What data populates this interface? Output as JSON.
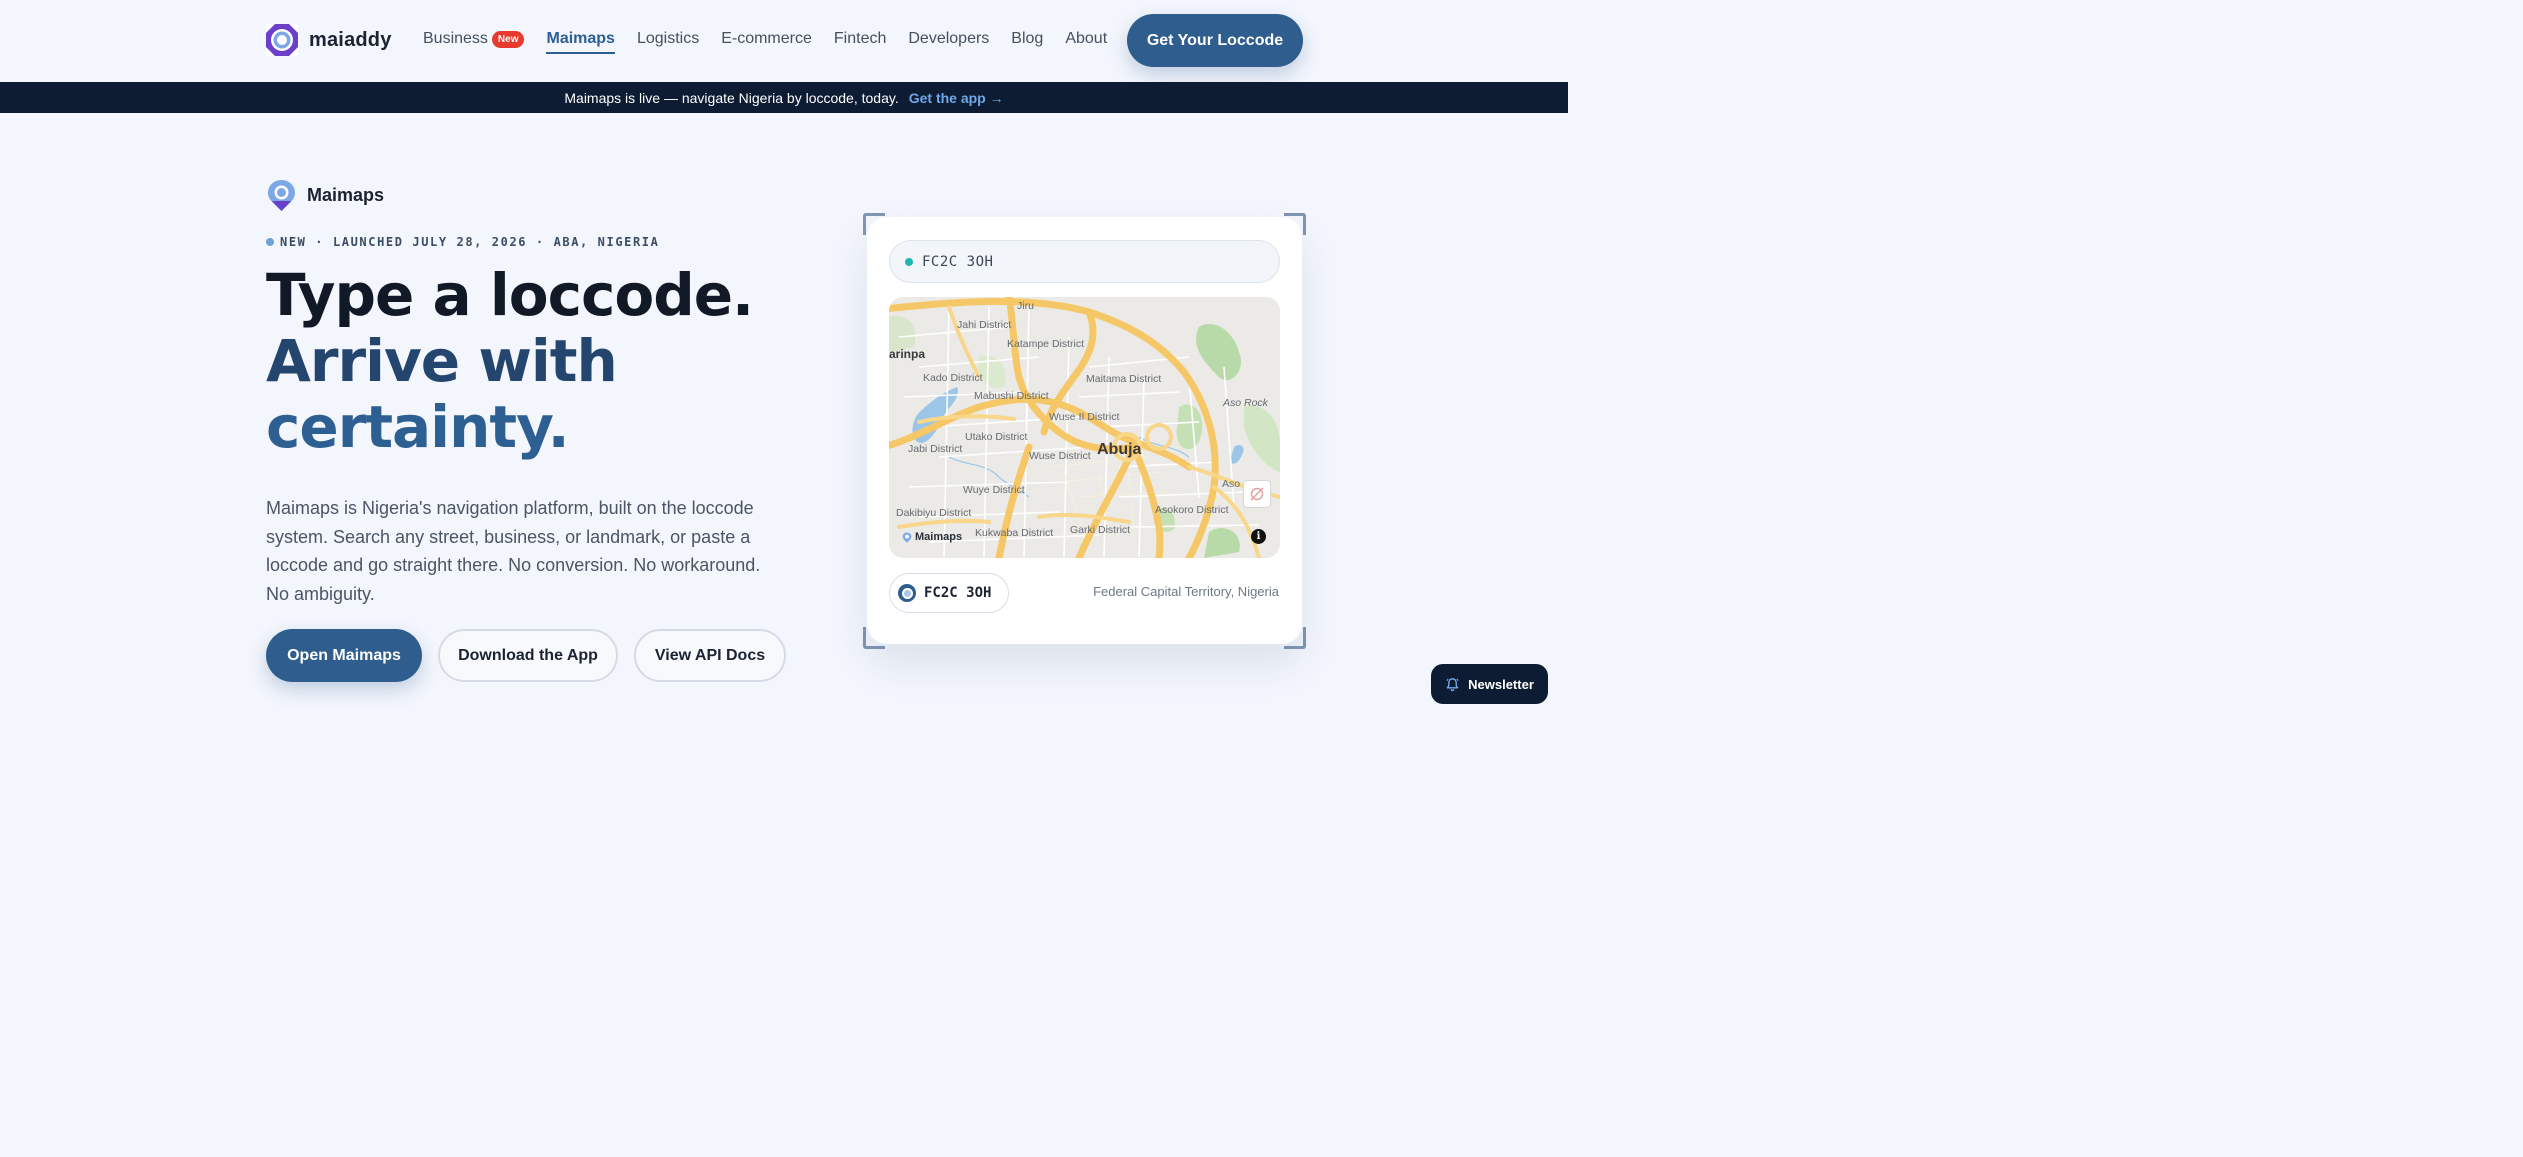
{
  "brand": {
    "name": "maiaddy"
  },
  "nav": {
    "items": [
      {
        "label": "Business",
        "badge": "New"
      },
      {
        "label": "Maimaps",
        "active": true
      },
      {
        "label": "Logistics"
      },
      {
        "label": "E-commerce"
      },
      {
        "label": "Fintech"
      },
      {
        "label": "Developers"
      },
      {
        "label": "Blog"
      },
      {
        "label": "About"
      }
    ],
    "cta": "Get Your Loccode"
  },
  "banner": {
    "text": "Maimaps is live — navigate Nigeria by loccode, today.",
    "link": "Get the app →"
  },
  "hero": {
    "product": "Maimaps",
    "launch": "NEW · LAUNCHED JULY 28, 2026 · ABA, NIGERIA",
    "headline": [
      "Type a loccode.",
      "Arrive with",
      "certainty."
    ],
    "description": "Maimaps is Nigeria's navigation platform, built on the loccode system. Search any street, business, or landmark, or paste a loccode and go straight there. No conversion. No workaround. No ambiguity.",
    "buttons": {
      "primary": "Open Maimaps",
      "download": "Download the App",
      "api": "View API Docs"
    }
  },
  "map_card": {
    "search_value": "FC2C 3OH",
    "map_labels": {
      "jiru": "Jiru",
      "jahi": "Jahi District",
      "katampe": "Katampe District",
      "karinpa": "arinpa",
      "maitama": "Maitama District",
      "kado": "Kado District",
      "mabushi": "Mabushi District",
      "aso_rock": "Aso Rock",
      "wuse2": "Wuse II District",
      "utako": "Utako District",
      "jabi": "Jabi District",
      "abuja": "Abuja",
      "wuse": "Wuse District",
      "wuye": "Wuye District",
      "aso": "Aso",
      "dakibiyu": "Dakibiyu District",
      "asokoro": "Asokoro District",
      "garki": "Garki District",
      "kukwaba": "Kukwaba District"
    },
    "map_brand": "Maimaps",
    "map_info": "i",
    "code": "FC2C 3OH",
    "region": "Federal Capital Territory, Nigeria"
  },
  "newsletter": {
    "label": "Newsletter"
  },
  "colors": {
    "primary": "#2e5d8e",
    "dark": "#0d1b33",
    "accent_link": "#6fa8e8",
    "badge_red": "#e8392e",
    "teal_dot": "#1fb5b0"
  }
}
